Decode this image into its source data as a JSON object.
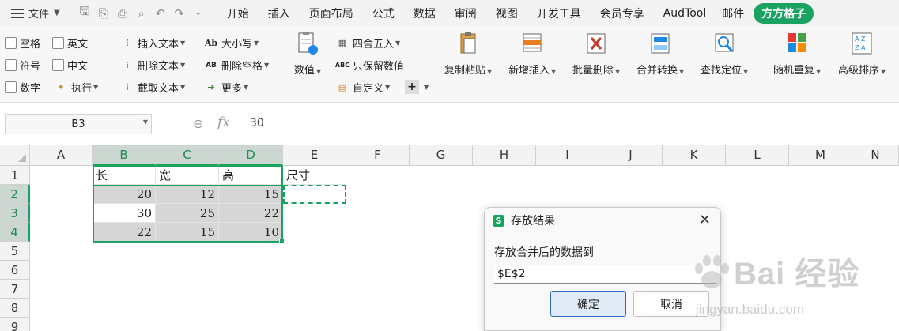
{
  "menubar": {
    "file_label": "文件",
    "tabs": [
      "开始",
      "插入",
      "页面布局",
      "公式",
      "数据",
      "审阅",
      "视图",
      "开发工具",
      "会员专享",
      "AudTool",
      "邮件"
    ],
    "active_tab": "方方格子"
  },
  "ribbon": {
    "checkboxes": [
      "空格",
      "英文",
      "符号",
      "中文",
      "数字"
    ],
    "exec_label": "执行",
    "text_tools": [
      "插入文本",
      "删除文本",
      "截取文本"
    ],
    "case_tools": [
      "大小写",
      "删除空格",
      "更多"
    ],
    "icon_text": {
      "case": "Ab",
      "delspace": "AB",
      "keepnum": "ABC"
    },
    "number_label": "数值",
    "round_label": "四舍五入",
    "keep_num_label": "只保留数值",
    "custom_label": "自定义",
    "big_buttons": [
      "复制粘贴",
      "新增插入",
      "批量删除",
      "合并转换",
      "查找定位",
      "随机重复",
      "高级排序"
    ],
    "sort_icon_text": {
      "top": "A Z",
      "bottom": "Z A"
    }
  },
  "formula_bar": {
    "name_box": "B3",
    "fx_label": "fx",
    "value": "30"
  },
  "sheet": {
    "columns": [
      "A",
      "B",
      "C",
      "D",
      "E",
      "F",
      "G",
      "H",
      "I",
      "J",
      "K",
      "L",
      "M",
      "N"
    ],
    "rows": [
      "1",
      "2",
      "3",
      "4",
      "5",
      "6",
      "7",
      "8",
      "9"
    ],
    "headers": [
      "长",
      "宽",
      "高",
      "尺寸"
    ],
    "data": [
      [
        "20",
        "12",
        "15"
      ],
      [
        "30",
        "25",
        "22"
      ],
      [
        "22",
        "15",
        "10"
      ]
    ]
  },
  "dialog": {
    "logo": "S",
    "title": "存放结果",
    "prompt": "存放合并后的数据到",
    "value": "$E$2",
    "ok": "确定",
    "cancel": "取消"
  },
  "watermark": {
    "main": "Bai 经验",
    "sub": "jingyan.baidu.com"
  },
  "colors": {
    "accent": "#1aa260",
    "selection_header": "#cdd7d1",
    "shade": "#d6d6d6"
  }
}
